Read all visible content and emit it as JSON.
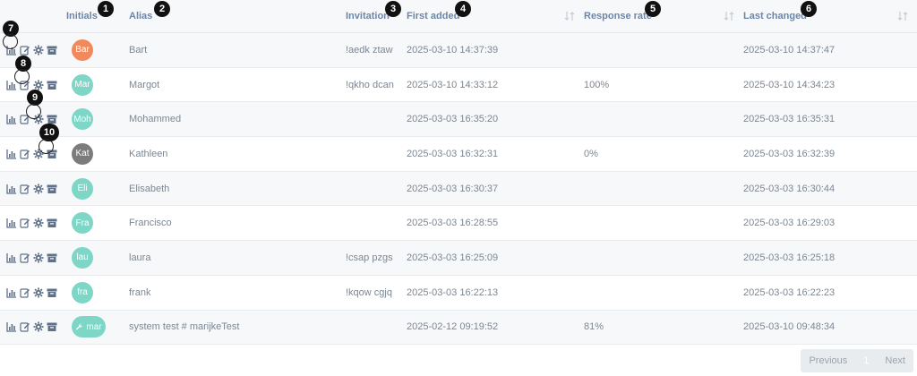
{
  "columns": {
    "initials": "Initials",
    "alias": "Alias",
    "invitation": "Invitation",
    "first_added": "First added",
    "response_rate": "Response rate",
    "last_changed": "Last changed"
  },
  "rows": [
    {
      "avatar": "Bar",
      "avatar_color": "#f08a5d",
      "alias": "Bart",
      "invitation": "!aedk ztaw",
      "first_added": "2025-03-10 14:37:39",
      "response_rate": "",
      "last_changed": "2025-03-10 14:37:47"
    },
    {
      "avatar": "Mar",
      "avatar_color": "#7ed6c6",
      "alias": "Margot",
      "invitation": "!qkho dcan",
      "first_added": "2025-03-10 14:33:12",
      "response_rate": "100%",
      "last_changed": "2025-03-10 14:34:23"
    },
    {
      "avatar": "Moh",
      "avatar_color": "#7ed6c6",
      "alias": "Mohammed",
      "invitation": "",
      "first_added": "2025-03-03 16:35:20",
      "response_rate": "",
      "last_changed": "2025-03-03 16:35:31"
    },
    {
      "avatar": "Kat",
      "avatar_color": "#7c7c7c",
      "alias": "Kathleen",
      "invitation": "",
      "first_added": "2025-03-03 16:32:31",
      "response_rate": "0%",
      "last_changed": "2025-03-03 16:32:39"
    },
    {
      "avatar": "Eli",
      "avatar_color": "#7ed6c6",
      "alias": "Elisabeth",
      "invitation": "",
      "first_added": "2025-03-03 16:30:37",
      "response_rate": "",
      "last_changed": "2025-03-03 16:30:44"
    },
    {
      "avatar": "Fra",
      "avatar_color": "#7ed6c6",
      "alias": "Francisco",
      "invitation": "",
      "first_added": "2025-03-03 16:28:55",
      "response_rate": "",
      "last_changed": "2025-03-03 16:29:03"
    },
    {
      "avatar": "lau",
      "avatar_color": "#7ed6c6",
      "alias": "laura",
      "invitation": "!csap pzgs",
      "first_added": "2025-03-03 16:25:09",
      "response_rate": "",
      "last_changed": "2025-03-03 16:25:18"
    },
    {
      "avatar": "fra",
      "avatar_color": "#7ed6c6",
      "alias": "frank",
      "invitation": "!kqow cgjq",
      "first_added": "2025-03-03 16:22:13",
      "response_rate": "",
      "last_changed": "2025-03-03 16:22:23"
    },
    {
      "avatar": "mar",
      "avatar_color": "#7ed6c6",
      "avatar_icon": "wrench-icon",
      "alias": "system test # marijkeTest",
      "invitation": "",
      "first_added": "2025-02-12 09:19:52",
      "response_rate": "81%",
      "last_changed": "2025-03-10 09:48:34"
    }
  ],
  "markers": [
    "1",
    "2",
    "3",
    "4",
    "5",
    "6",
    "7",
    "8",
    "9",
    "10"
  ],
  "pagination": {
    "previous": "Previous",
    "current": "1",
    "next": "Next"
  },
  "icons": {
    "row_actions": [
      "chart-icon",
      "edit-icon",
      "gear-icon",
      "archive-icon"
    ],
    "sort": "sort-icon"
  }
}
